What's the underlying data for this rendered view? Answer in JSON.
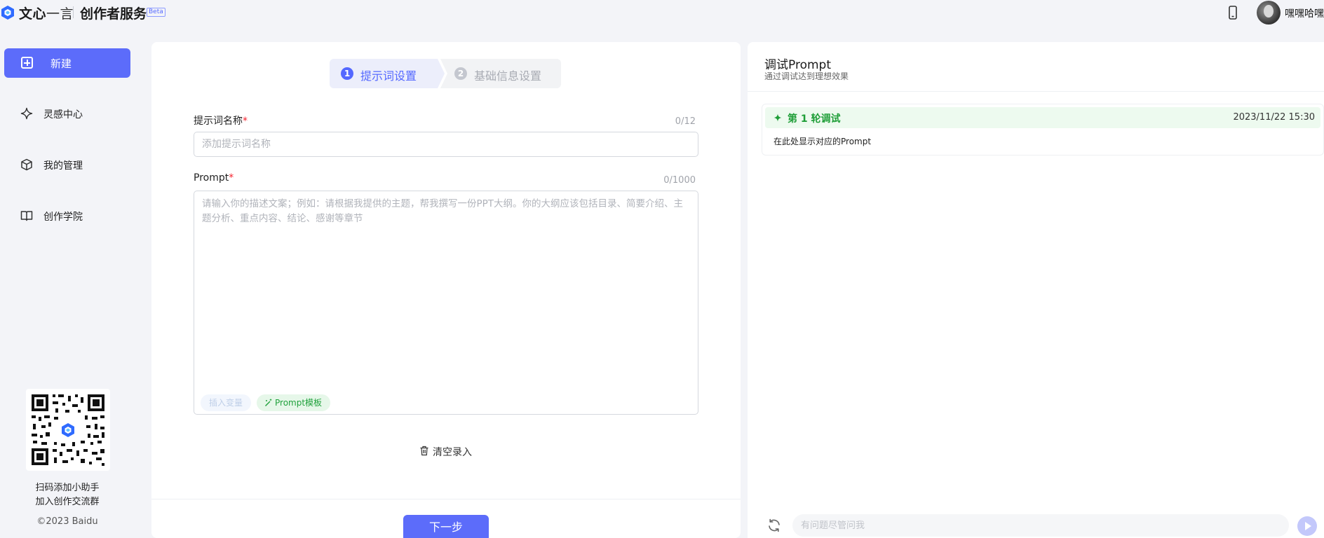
{
  "header": {
    "brand_main": "文心",
    "brand_thin": "一言",
    "product": "创作者服务",
    "beta": "Beta",
    "username": "嘿嘿哈嘿"
  },
  "sidebar": {
    "new_label": "新建",
    "items": [
      {
        "label": "灵感中心",
        "icon": "sparkle-icon"
      },
      {
        "label": "我的管理",
        "icon": "cube-icon"
      },
      {
        "label": "创作学院",
        "icon": "book-icon"
      }
    ],
    "qr_caption_line1": "扫码添加小助手",
    "qr_caption_line2": "加入创作交流群",
    "copyright": "©2023 Baidu"
  },
  "form": {
    "steps": [
      {
        "num": "1",
        "label": "提示词设置",
        "active": true
      },
      {
        "num": "2",
        "label": "基础信息设置",
        "active": false
      }
    ],
    "name_label": "提示词名称",
    "required_mark": "*",
    "name_counter": "0/12",
    "name_value": "",
    "name_placeholder": "添加提示词名称",
    "prompt_label": "Prompt",
    "prompt_counter": "0/1000",
    "prompt_value": "",
    "prompt_placeholder": "请输入你的描述文案；例如：请根据我提供的主题，帮我撰写一份PPT大纲。你的大纲应该包括目录、简要介绍、主题分析、重点内容、结论、感谢等章节",
    "insert_var_label": "插入变量",
    "template_label": "Prompt模板",
    "clear_label": "清空录入",
    "next_label": "下一步"
  },
  "debug": {
    "title": "调试Prompt",
    "subtitle": "通过调试达到理想效果",
    "round_label": "第 1 轮调试",
    "round_time": "2023/11/22 15:30",
    "round_body": "在此处显示对应的Prompt",
    "ask_value": "",
    "ask_placeholder": "有问题尽管问我"
  },
  "colors": {
    "accent": "#5c6cfa",
    "success": "#1f9e38",
    "required": "#f5222d"
  }
}
